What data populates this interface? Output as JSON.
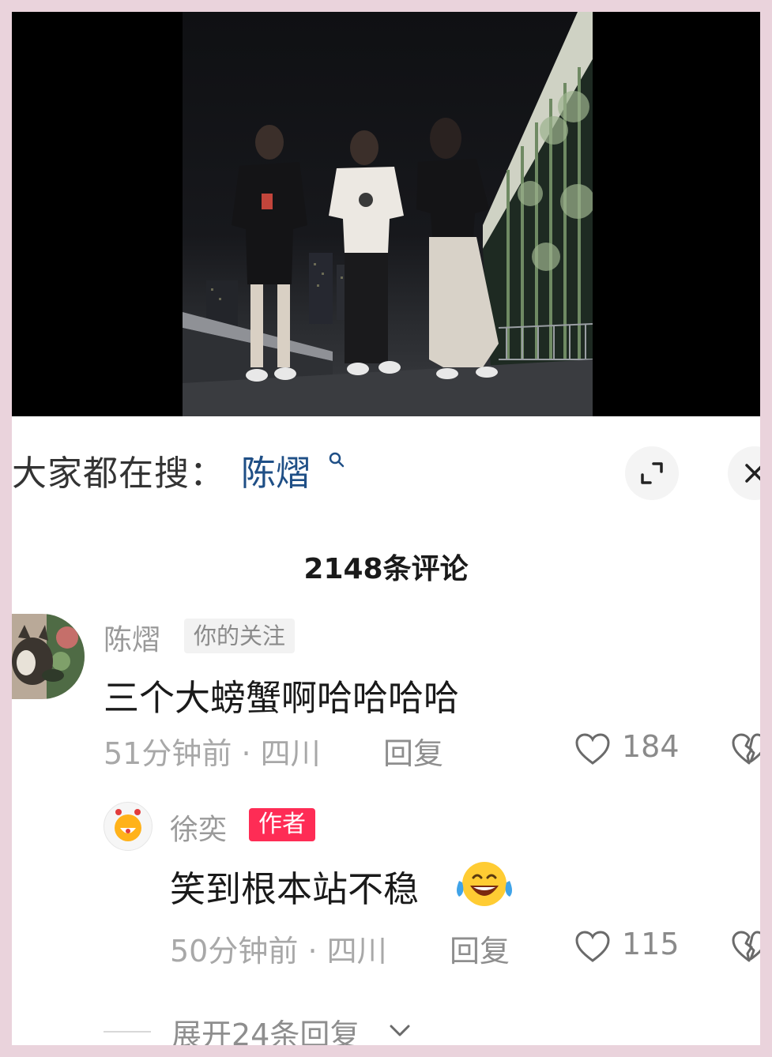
{
  "search": {
    "prefix": "大家都在搜：",
    "term": "陈熠"
  },
  "comments_header": {
    "count_label": "2148条评论"
  },
  "comment": {
    "username": "陈熠",
    "tag": "你的关注",
    "text": "三个大螃蟹啊哈哈哈哈",
    "time": "51分钟前",
    "location": "四川",
    "separator": "·",
    "reply_label": "回复",
    "likes": "184"
  },
  "reply": {
    "username": "徐奕",
    "tag": "作者",
    "text": "笑到根本站不稳",
    "emoji": "face-with-tears-of-joy",
    "time": "50分钟前",
    "location": "四川",
    "separator": "·",
    "reply_label": "回复",
    "likes": "115"
  },
  "expand": {
    "label": "展开24条回复"
  },
  "colors": {
    "accent_red": "#fe2c55",
    "search_term_blue": "#1f4f86",
    "page_border_pink": "#ead3dc"
  }
}
